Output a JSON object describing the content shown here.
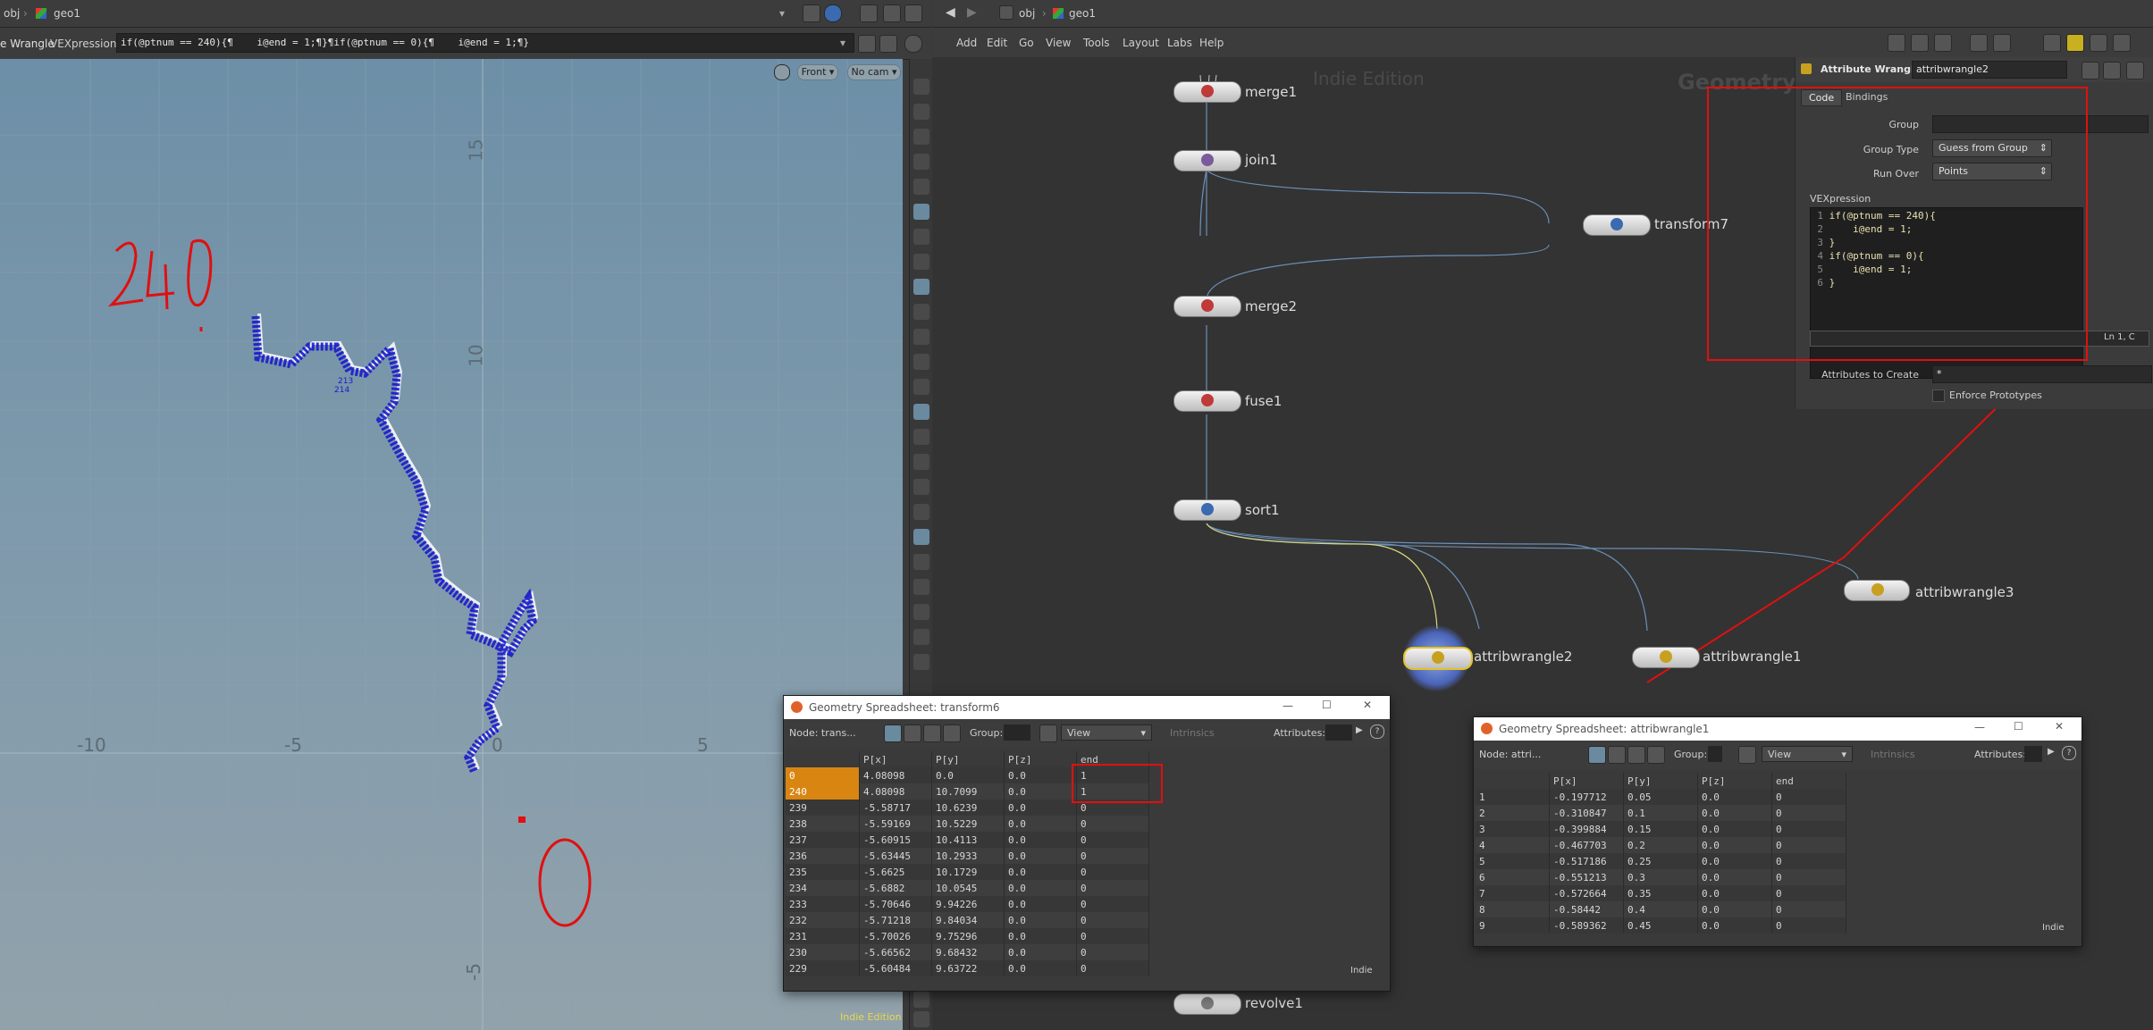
{
  "left_pane": {
    "path": {
      "obj": "obj",
      "geo": "geo1"
    },
    "node_type_label": "e Wrangle",
    "parm_label": "VEXpression",
    "parm_value": "if(@ptnum == 240){¶    i@end = 1;¶}¶if(@ptnum == 0){¶    i@end = 1;¶}",
    "view_dropdown": "Front",
    "cam_dropdown": "No cam",
    "grid_labels": {
      "x_neg10": "-10",
      "x_neg5": "-5",
      "x_0": "0",
      "x_5": "5",
      "y_15": "15",
      "y_10": "10",
      "y_neg5": "-5"
    },
    "point_labels": [
      "213",
      "214"
    ],
    "handwritten_annotation": "240",
    "edition_watermark": "Indie Edition"
  },
  "right_pane": {
    "path": {
      "obj": "obj",
      "geo": "geo1"
    },
    "menu": [
      "Add",
      "Edit",
      "Go",
      "View",
      "Tools",
      "Layout",
      "Labs",
      "Help"
    ],
    "watermark": "Indie Edition",
    "context_label": "Geometry",
    "nodes": [
      {
        "label": "merge1",
        "icon_color": "#c03a3a"
      },
      {
        "label": "join1",
        "icon_color": "#7a5a9a"
      },
      {
        "label": "transform7",
        "icon_color": "#3a6ab0"
      },
      {
        "label": "merge2",
        "icon_color": "#c03a3a"
      },
      {
        "label": "fuse1",
        "icon_color": "#c03a3a"
      },
      {
        "label": "sort1",
        "icon_color": "#3a6ab0"
      },
      {
        "label": "attribwrangle3",
        "icon_color": "#c8a020"
      },
      {
        "label": "attribwrangle2",
        "icon_color": "#c8a020"
      },
      {
        "label": "attribwrangle1",
        "icon_color": "#c8a020"
      },
      {
        "label": "revolve1",
        "icon_color": "#7a7a7a"
      }
    ]
  },
  "param_panel": {
    "node_type": "Attribute Wrangle",
    "node_name": "attribwrangle2",
    "tabs": [
      "Code",
      "Bindings"
    ],
    "group_label": "Group",
    "group_value": "",
    "group_type_label": "Group Type",
    "group_type_value": "Guess from Group",
    "run_over_label": "Run Over",
    "run_over_value": "Points",
    "vex_label": "VEXpression",
    "code_lines": [
      {
        "n": "1",
        "t": "if(@ptnum == 240){"
      },
      {
        "n": "2",
        "t": "    i@end = 1;"
      },
      {
        "n": "3",
        "t": "}"
      },
      {
        "n": "4",
        "t": "if(@ptnum == 0){"
      },
      {
        "n": "5",
        "t": "    i@end = 1;"
      },
      {
        "n": "6",
        "t": "}"
      }
    ],
    "cursor_pos": "Ln 1, C",
    "attrs_create_label": "Attributes to Create",
    "attrs_create_value": "*",
    "enforce_label": "Enforce Prototypes"
  },
  "spreadsheet1": {
    "title": "Geometry Spreadsheet: transform6",
    "node_label": "Node: trans...",
    "group_label": "Group:",
    "view_label": "View",
    "intrinsics_label": "Intrinsics",
    "attributes_label": "Attributes:",
    "columns": [
      "",
      "P[x]",
      "P[y]",
      "P[z]",
      "end"
    ],
    "rows": [
      [
        "0",
        "4.08098",
        "0.0",
        "0.0",
        "1"
      ],
      [
        "240",
        "4.08098",
        "10.7099",
        "0.0",
        "1"
      ],
      [
        "239",
        "-5.58717",
        "10.6239",
        "0.0",
        "0"
      ],
      [
        "238",
        "-5.59169",
        "10.5229",
        "0.0",
        "0"
      ],
      [
        "237",
        "-5.60915",
        "10.4113",
        "0.0",
        "0"
      ],
      [
        "236",
        "-5.63445",
        "10.2933",
        "0.0",
        "0"
      ],
      [
        "235",
        "-5.6625",
        "10.1729",
        "0.0",
        "0"
      ],
      [
        "234",
        "-5.6882",
        "10.0545",
        "0.0",
        "0"
      ],
      [
        "233",
        "-5.70646",
        "9.94226",
        "0.0",
        "0"
      ],
      [
        "232",
        "-5.71218",
        "9.84034",
        "0.0",
        "0"
      ],
      [
        "231",
        "-5.70026",
        "9.75296",
        "0.0",
        "0"
      ],
      [
        "230",
        "-5.66562",
        "9.68432",
        "0.0",
        "0"
      ],
      [
        "229",
        "-5.60484",
        "9.63722",
        "0.0",
        "0"
      ]
    ],
    "footer": "Indie"
  },
  "spreadsheet2": {
    "title": "Geometry Spreadsheet: attribwrangle1",
    "node_label": "Node: attri...",
    "group_label": "Group:",
    "view_label": "View",
    "intrinsics_label": "Intrinsics",
    "attributes_label": "Attributes:",
    "columns": [
      "",
      "P[x]",
      "P[y]",
      "P[z]",
      "end"
    ],
    "rows": [
      [
        "1",
        "-0.197712",
        "0.05",
        "0.0",
        "0"
      ],
      [
        "2",
        "-0.310847",
        "0.1",
        "0.0",
        "0"
      ],
      [
        "3",
        "-0.399884",
        "0.15",
        "0.0",
        "0"
      ],
      [
        "4",
        "-0.467703",
        "0.2",
        "0.0",
        "0"
      ],
      [
        "5",
        "-0.517186",
        "0.25",
        "0.0",
        "0"
      ],
      [
        "6",
        "-0.551213",
        "0.3",
        "0.0",
        "0"
      ],
      [
        "7",
        "-0.572664",
        "0.35",
        "0.0",
        "0"
      ],
      [
        "8",
        "-0.58442",
        "0.4",
        "0.0",
        "0"
      ],
      [
        "9",
        "-0.589362",
        "0.45",
        "0.0",
        "0"
      ]
    ],
    "footer": "Indie"
  },
  "colors": {
    "selection": "#d98512",
    "annotation_red": "#e01010",
    "curve_blue": "#1a1acc"
  }
}
